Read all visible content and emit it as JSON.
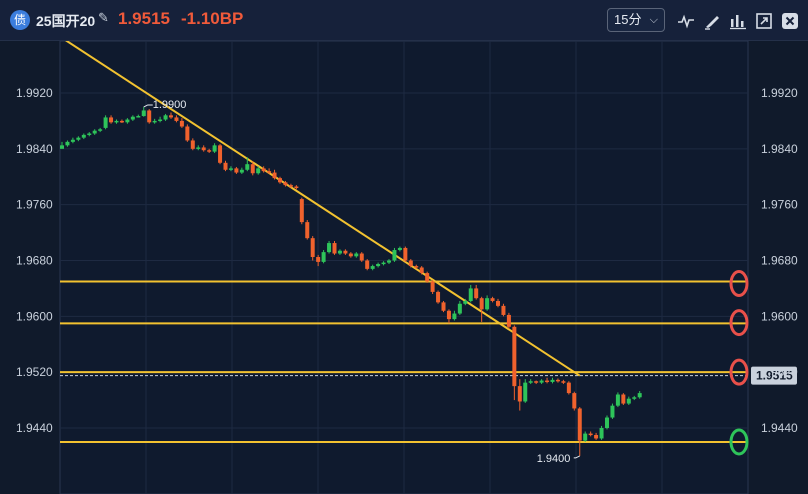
{
  "header": {
    "badge": "债",
    "instrument": "25国开20",
    "price": "1.9515",
    "change": "-1.10BP",
    "period": "15分",
    "tools": [
      "indicator-icon",
      "draw-tool-icon",
      "bar-chart-icon",
      "expand-icon",
      "close-icon"
    ]
  },
  "colors": {
    "up": "#2ec45a",
    "down": "#f0622d",
    "line": "#f2c230",
    "mark_red": "#e8504a",
    "mark_green": "#2ec45a"
  },
  "chart_data": {
    "type": "candlestick",
    "y_ticks": [
      "1.9920",
      "1.9840",
      "1.9760",
      "1.9680",
      "1.9600",
      "1.9520",
      "1.9440"
    ],
    "ylim": [
      1.9365,
      2.0
    ],
    "current_price_label": "1.9515",
    "annotations": {
      "high_label": "1.9900",
      "low_label": "1.9400"
    },
    "horizontal_lines": [
      1.965,
      1.959,
      1.952,
      1.942
    ],
    "trend_line": {
      "from": [
        0,
        1.9999
      ],
      "to": [
        95,
        1.9515
      ]
    },
    "circle_markers": [
      {
        "price": 1.9647,
        "color": "red"
      },
      {
        "price": 1.9591,
        "color": "red"
      },
      {
        "price": 1.952,
        "color": "red"
      },
      {
        "price": 1.942,
        "color": "green"
      }
    ],
    "candles": [
      [
        1.984,
        1.9845,
        1.9842,
        1.985
      ],
      [
        1.9845,
        1.985,
        1.9843,
        1.9852
      ],
      [
        1.985,
        1.9853,
        1.9848,
        1.9856
      ],
      [
        1.9853,
        1.9856,
        1.9851,
        1.9858
      ],
      [
        1.9856,
        1.986,
        1.9854,
        1.9862
      ],
      [
        1.986,
        1.9862,
        1.9858,
        1.9864
      ],
      [
        1.9862,
        1.9866,
        1.986,
        1.9868
      ],
      [
        1.9866,
        1.9868,
        1.9864,
        1.987
      ],
      [
        1.987,
        1.9885,
        1.9868,
        1.9888
      ],
      [
        1.9885,
        1.9878,
        1.9876,
        1.9888
      ],
      [
        1.9878,
        1.988,
        1.9876,
        1.9882
      ],
      [
        1.988,
        1.9878,
        1.9877,
        1.9882
      ],
      [
        1.9878,
        1.9882,
        1.9876,
        1.9884
      ],
      [
        1.9882,
        1.9886,
        1.988,
        1.9888
      ],
      [
        1.9886,
        1.9887,
        1.9885,
        1.9889
      ],
      [
        1.9887,
        1.9895,
        1.9886,
        1.99
      ],
      [
        1.9895,
        1.9878,
        1.9876,
        1.9897
      ],
      [
        1.9878,
        1.988,
        1.9876,
        1.9883
      ],
      [
        1.988,
        1.9882,
        1.9878,
        1.9886
      ],
      [
        1.9882,
        1.9888,
        1.988,
        1.989
      ],
      [
        1.9888,
        1.9885,
        1.9883,
        1.9892
      ],
      [
        1.9885,
        1.988,
        1.9878,
        1.9888
      ],
      [
        1.988,
        1.9872,
        1.987,
        1.9884
      ],
      [
        1.9872,
        1.9852,
        1.985,
        1.9875
      ],
      [
        1.9852,
        1.984,
        1.9838,
        1.9855
      ],
      [
        1.984,
        1.9842,
        1.9838,
        1.9845
      ],
      [
        1.9842,
        1.9838,
        1.9836,
        1.9845
      ],
      [
        1.9838,
        1.9836,
        1.9834,
        1.984
      ],
      [
        1.9836,
        1.9845,
        1.9834,
        1.9848
      ],
      [
        1.9845,
        1.982,
        1.9818,
        1.9847
      ],
      [
        1.982,
        1.981,
        1.9808,
        1.9823
      ],
      [
        1.981,
        1.9812,
        1.9808,
        1.9815
      ],
      [
        1.9812,
        1.9806,
        1.9804,
        1.9814
      ],
      [
        1.9806,
        1.981,
        1.9804,
        1.9813
      ],
      [
        1.981,
        1.9818,
        1.9808,
        1.9828
      ],
      [
        1.9818,
        1.9805,
        1.9802,
        1.9822
      ],
      [
        1.9805,
        1.9812,
        1.9803,
        1.9815
      ],
      [
        1.9812,
        1.9808,
        1.9806,
        1.9815
      ],
      [
        1.9808,
        1.9806,
        1.9804,
        1.9812
      ],
      [
        1.9806,
        1.9798,
        1.9796,
        1.981
      ],
      [
        1.9798,
        1.9792,
        1.979,
        1.98
      ],
      [
        1.9792,
        1.9788,
        1.9786,
        1.9794
      ],
      [
        1.9788,
        1.9786,
        1.9784,
        1.979
      ],
      [
        1.9786,
        1.9784,
        1.9782,
        1.9788
      ],
      [
        1.9768,
        1.9735,
        1.9732,
        1.977
      ],
      [
        1.9735,
        1.9712,
        1.971,
        1.9738
      ],
      [
        1.9712,
        1.9685,
        1.968,
        1.9715
      ],
      [
        1.9685,
        1.9678,
        1.9672,
        1.9688
      ],
      [
        1.9678,
        1.9692,
        1.9676,
        1.9695
      ],
      [
        1.9692,
        1.9705,
        1.969,
        1.9708
      ],
      [
        1.9705,
        1.969,
        1.9688,
        1.9708
      ],
      [
        1.969,
        1.9694,
        1.9688,
        1.9696
      ],
      [
        1.9694,
        1.969,
        1.9688,
        1.9696
      ],
      [
        1.969,
        1.9686,
        1.9684,
        1.9692
      ],
      [
        1.9686,
        1.969,
        1.9684,
        1.9692
      ],
      [
        1.969,
        1.968,
        1.9678,
        1.9692
      ],
      [
        1.968,
        1.9668,
        1.9666,
        1.9682
      ],
      [
        1.9668,
        1.9672,
        1.9666,
        1.9674
      ],
      [
        1.9672,
        1.9675,
        1.967,
        1.9677
      ],
      [
        1.9675,
        1.9677,
        1.9673,
        1.9679
      ],
      [
        1.9677,
        1.968,
        1.9675,
        1.9682
      ],
      [
        1.968,
        1.9695,
        1.9678,
        1.9698
      ],
      [
        1.9695,
        1.9698,
        1.9693,
        1.97
      ],
      [
        1.9698,
        1.968,
        1.9678,
        1.97
      ],
      [
        1.968,
        1.9672,
        1.967,
        1.9682
      ],
      [
        1.9672,
        1.967,
        1.9668,
        1.9674
      ],
      [
        1.967,
        1.9662,
        1.966,
        1.9672
      ],
      [
        1.9662,
        1.965,
        1.9648,
        1.9664
      ],
      [
        1.965,
        1.9635,
        1.9632,
        1.9652
      ],
      [
        1.9635,
        1.962,
        1.9618,
        1.9637
      ],
      [
        1.962,
        1.9608,
        1.9606,
        1.9622
      ],
      [
        1.9608,
        1.9596,
        1.959,
        1.961
      ],
      [
        1.9596,
        1.9604,
        1.9594,
        1.9608
      ],
      [
        1.9604,
        1.9618,
        1.9602,
        1.9622
      ],
      [
        1.9618,
        1.9622,
        1.9616,
        1.9625
      ],
      [
        1.9622,
        1.964,
        1.962,
        1.9645
      ],
      [
        1.964,
        1.9626,
        1.9624,
        1.9645
      ],
      [
        1.9626,
        1.961,
        1.9592,
        1.9628
      ],
      [
        1.961,
        1.9626,
        1.9608,
        1.963
      ],
      [
        1.9626,
        1.9622,
        1.962,
        1.9628
      ],
      [
        1.9622,
        1.9615,
        1.9613,
        1.9625
      ],
      [
        1.9615,
        1.9602,
        1.96,
        1.9618
      ],
      [
        1.9602,
        1.9585,
        1.9582,
        1.9605
      ],
      [
        1.9585,
        1.95,
        1.948,
        1.9587
      ],
      [
        1.95,
        1.9478,
        1.9465,
        1.951
      ],
      [
        1.9478,
        1.9505,
        1.9476,
        1.951
      ],
      [
        1.9505,
        1.9507,
        1.9503,
        1.951
      ],
      [
        1.9507,
        1.9505,
        1.9503,
        1.9508
      ],
      [
        1.9505,
        1.9508,
        1.9503,
        1.951
      ],
      [
        1.9508,
        1.9506,
        1.9504,
        1.9512
      ],
      [
        1.9506,
        1.9509,
        1.9504,
        1.9512
      ],
      [
        1.9509,
        1.9507,
        1.9505,
        1.9511
      ],
      [
        1.9507,
        1.9505,
        1.9503,
        1.9509
      ],
      [
        1.9505,
        1.949,
        1.9488,
        1.9507
      ],
      [
        1.949,
        1.9468,
        1.9465,
        1.9492
      ],
      [
        1.9468,
        1.9422,
        1.94,
        1.947
      ],
      [
        1.9422,
        1.9432,
        1.942,
        1.9435
      ],
      [
        1.9432,
        1.943,
        1.9428,
        1.9435
      ],
      [
        1.943,
        1.9425,
        1.9423,
        1.9433
      ],
      [
        1.9425,
        1.944,
        1.9423,
        1.9443
      ],
      [
        1.944,
        1.9455,
        1.9438,
        1.9458
      ],
      [
        1.9455,
        1.9472,
        1.9453,
        1.9475
      ],
      [
        1.9472,
        1.9488,
        1.947,
        1.9491
      ],
      [
        1.9488,
        1.9475,
        1.9473,
        1.949
      ],
      [
        1.9475,
        1.9482,
        1.9473,
        1.9485
      ],
      [
        1.9482,
        1.9484,
        1.948,
        1.9486
      ],
      [
        1.9484,
        1.949,
        1.9482,
        1.9493
      ]
    ]
  }
}
